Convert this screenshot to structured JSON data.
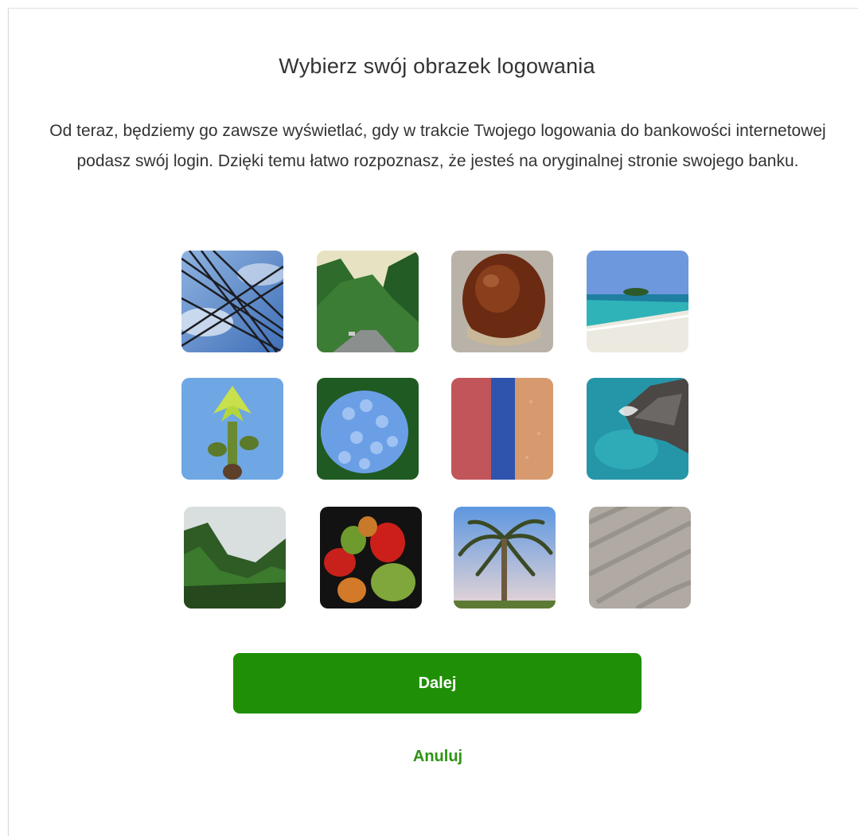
{
  "dialog": {
    "title": "Wybierz swój obrazek logowania",
    "description": "Od teraz, będziemy go zawsze wyświetlać, gdy w trakcie Twojego logowania do bankowości internetowej podasz swój login. Dzięki temu łatwo rozpoznasz, że jesteś na oryginalnej stronie swojego banku."
  },
  "images": [
    {
      "id": "power-lines",
      "icon": "power-lines-image"
    },
    {
      "id": "forest-road",
      "icon": "forest-road-image"
    },
    {
      "id": "chestnut",
      "icon": "chestnut-image"
    },
    {
      "id": "beach-island",
      "icon": "beach-island-image"
    },
    {
      "id": "green-sprout",
      "icon": "green-sprout-image"
    },
    {
      "id": "hydrangea",
      "icon": "hydrangea-image"
    },
    {
      "id": "colored-wall",
      "icon": "colored-wall-image"
    },
    {
      "id": "rocky-coast",
      "icon": "rocky-coast-image"
    },
    {
      "id": "misty-forest",
      "icon": "misty-forest-image"
    },
    {
      "id": "vegetables",
      "icon": "vegetables-image"
    },
    {
      "id": "palm-tree",
      "icon": "palm-tree-image"
    },
    {
      "id": "sand-ripples",
      "icon": "sand-ripples-image"
    }
  ],
  "buttons": {
    "next_label": "Dalej",
    "cancel_label": "Anuluj"
  },
  "colors": {
    "primary": "#1f9006",
    "link": "#2c9413",
    "text": "#333333"
  }
}
